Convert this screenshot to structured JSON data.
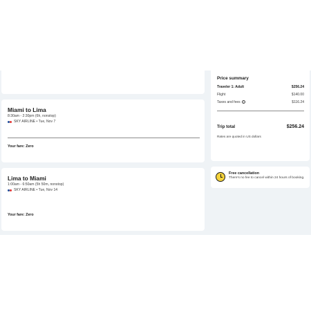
{
  "flights": [
    {
      "route": "Miami to Lima",
      "times": "8:30am - 2:30pm (6h, nonstop)",
      "airline": "SKY AIRLINE • Tue, Nov 7",
      "fare": "Your fare: Zero"
    },
    {
      "route": "Lima to Miami",
      "times": "1:00am - 6:50am (5h 50m, nonstop)",
      "airline": "SKY AIRLINE • Tue, Nov 14",
      "fare": "Your fare: Zero"
    }
  ],
  "price_summary": {
    "title": "Price summary",
    "traveler_label": "Traveler 1: Adult",
    "traveler_amount": "$256.24",
    "flight_label": "Flight",
    "flight_amount": "$140.00",
    "taxes_label": "Taxes and fees",
    "taxes_amount": "$116.24",
    "total_label": "Trip total",
    "total_amount": "$256.24",
    "note": "Rates are quoted in US dollars"
  },
  "cancellation": {
    "title": "Free cancellation",
    "text": "There's no fee to cancel within 24 hours of booking."
  },
  "colors": {
    "band_bg": "#eff3f6",
    "card_bg": "#ffffff",
    "clock_yellow": "#f4d23b"
  },
  "icons": {
    "airline": "sky-airline-logo-icon",
    "info": "info-icon",
    "clock": "clock-icon"
  }
}
